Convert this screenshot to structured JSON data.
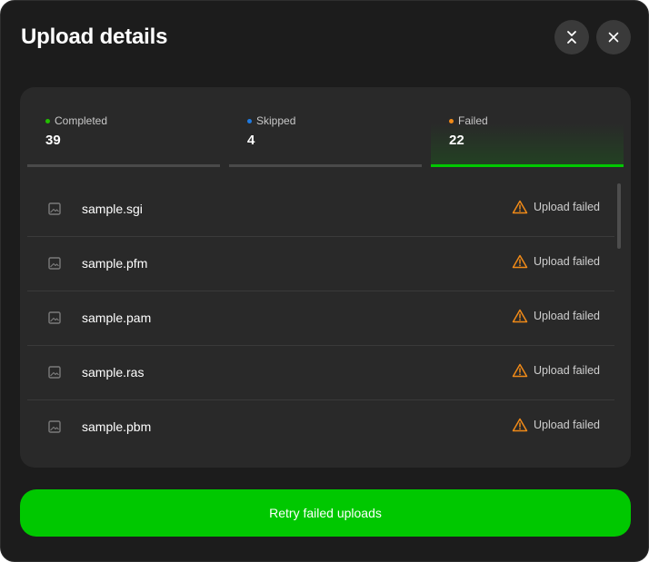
{
  "dialog": {
    "title": "Upload details",
    "collapse_icon": "collapse-arrows-icon",
    "close_icon": "close-icon"
  },
  "tabs": [
    {
      "label": "Completed",
      "count": "39",
      "dot_color": "#22c000",
      "active": false
    },
    {
      "label": "Skipped",
      "count": "4",
      "dot_color": "#1f7ae0",
      "active": false
    },
    {
      "label": "Failed",
      "count": "22",
      "dot_color": "#f08a18",
      "active": true
    }
  ],
  "files": [
    {
      "name": "sample.sgi",
      "status": "Upload failed",
      "icon": "image-file-icon",
      "status_icon": "warning-icon"
    },
    {
      "name": "sample.pfm",
      "status": "Upload failed",
      "icon": "image-file-icon",
      "status_icon": "warning-icon"
    },
    {
      "name": "sample.pam",
      "status": "Upload failed",
      "icon": "image-file-icon",
      "status_icon": "warning-icon"
    },
    {
      "name": "sample.ras",
      "status": "Upload failed",
      "icon": "image-file-icon",
      "status_icon": "warning-icon"
    },
    {
      "name": "sample.pbm",
      "status": "Upload failed",
      "icon": "image-file-icon",
      "status_icon": "warning-icon"
    }
  ],
  "retry_button": {
    "label": "Retry failed uploads"
  },
  "colors": {
    "accent": "#00c800",
    "warning": "#f08a18",
    "background": "#1c1c1c",
    "panel": "#292929"
  }
}
